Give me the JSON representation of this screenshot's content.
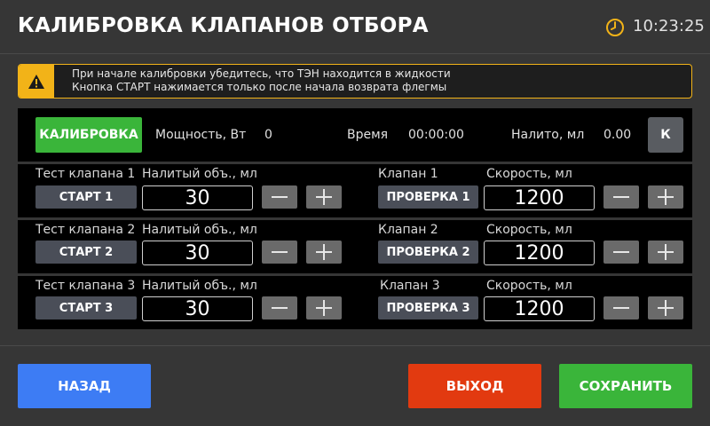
{
  "header": {
    "title": "КАЛИБРОВКА КЛАПАНОВ ОТБОРА",
    "time": "10:23:25"
  },
  "warning": {
    "line1": "При начале калибровки убедитесь, что ТЭН находится в жидкости",
    "line2": "Кнопка СТАРТ нажимается только после начала возврата флегмы"
  },
  "calibration": {
    "button_label": "КАЛИБРОВКА",
    "power_label": "Мощность, Вт",
    "power_value": "0",
    "time_label": "Время",
    "time_value": "00:00:00",
    "poured_label": "Налито, мл",
    "poured_value": "0.00",
    "k_label": "К"
  },
  "tests": [
    {
      "test_label": "Тест клапана 1",
      "start_label": "СТАРТ 1",
      "volume_label": "Налитый объ., мл",
      "volume_value": "30",
      "valve_label": "Клапан 1",
      "check_label": "ПРОВЕРКА 1",
      "speed_label": "Скорость, мл",
      "speed_value": "1200"
    },
    {
      "test_label": "Тест клапана 2",
      "start_label": "СТАРТ 2",
      "volume_label": "Налитый объ., мл",
      "volume_value": "30",
      "valve_label": "Клапан 2",
      "check_label": "ПРОВЕРКА 2",
      "speed_label": "Скорость, мл",
      "speed_value": "1200"
    },
    {
      "test_label": "Тест клапана 3",
      "start_label": "СТАРТ 3",
      "volume_label": "Налитый объ., мл",
      "volume_value": "30",
      "valve_label": "Клапан 3",
      "check_label": "ПРОВЕРКА 3",
      "speed_label": "Скорость, мл",
      "speed_value": "1200"
    }
  ],
  "footer": {
    "back_label": "НАЗАД",
    "exit_label": "ВЫХОД",
    "save_label": "СОХРАНИТЬ"
  },
  "icons": {
    "clock": "clock-icon",
    "warning": "warning-icon",
    "minus": "minus-icon",
    "plus": "plus-icon"
  },
  "colors": {
    "background": "#363636",
    "warning_accent": "#f2b318",
    "calibrate_green": "#3ab53a",
    "back_blue": "#3d7cf4",
    "exit_red": "#e23a10",
    "save_green": "#3ab53a",
    "dark_button": "#4a4e58",
    "stepper_gray": "#6a6a6a"
  }
}
